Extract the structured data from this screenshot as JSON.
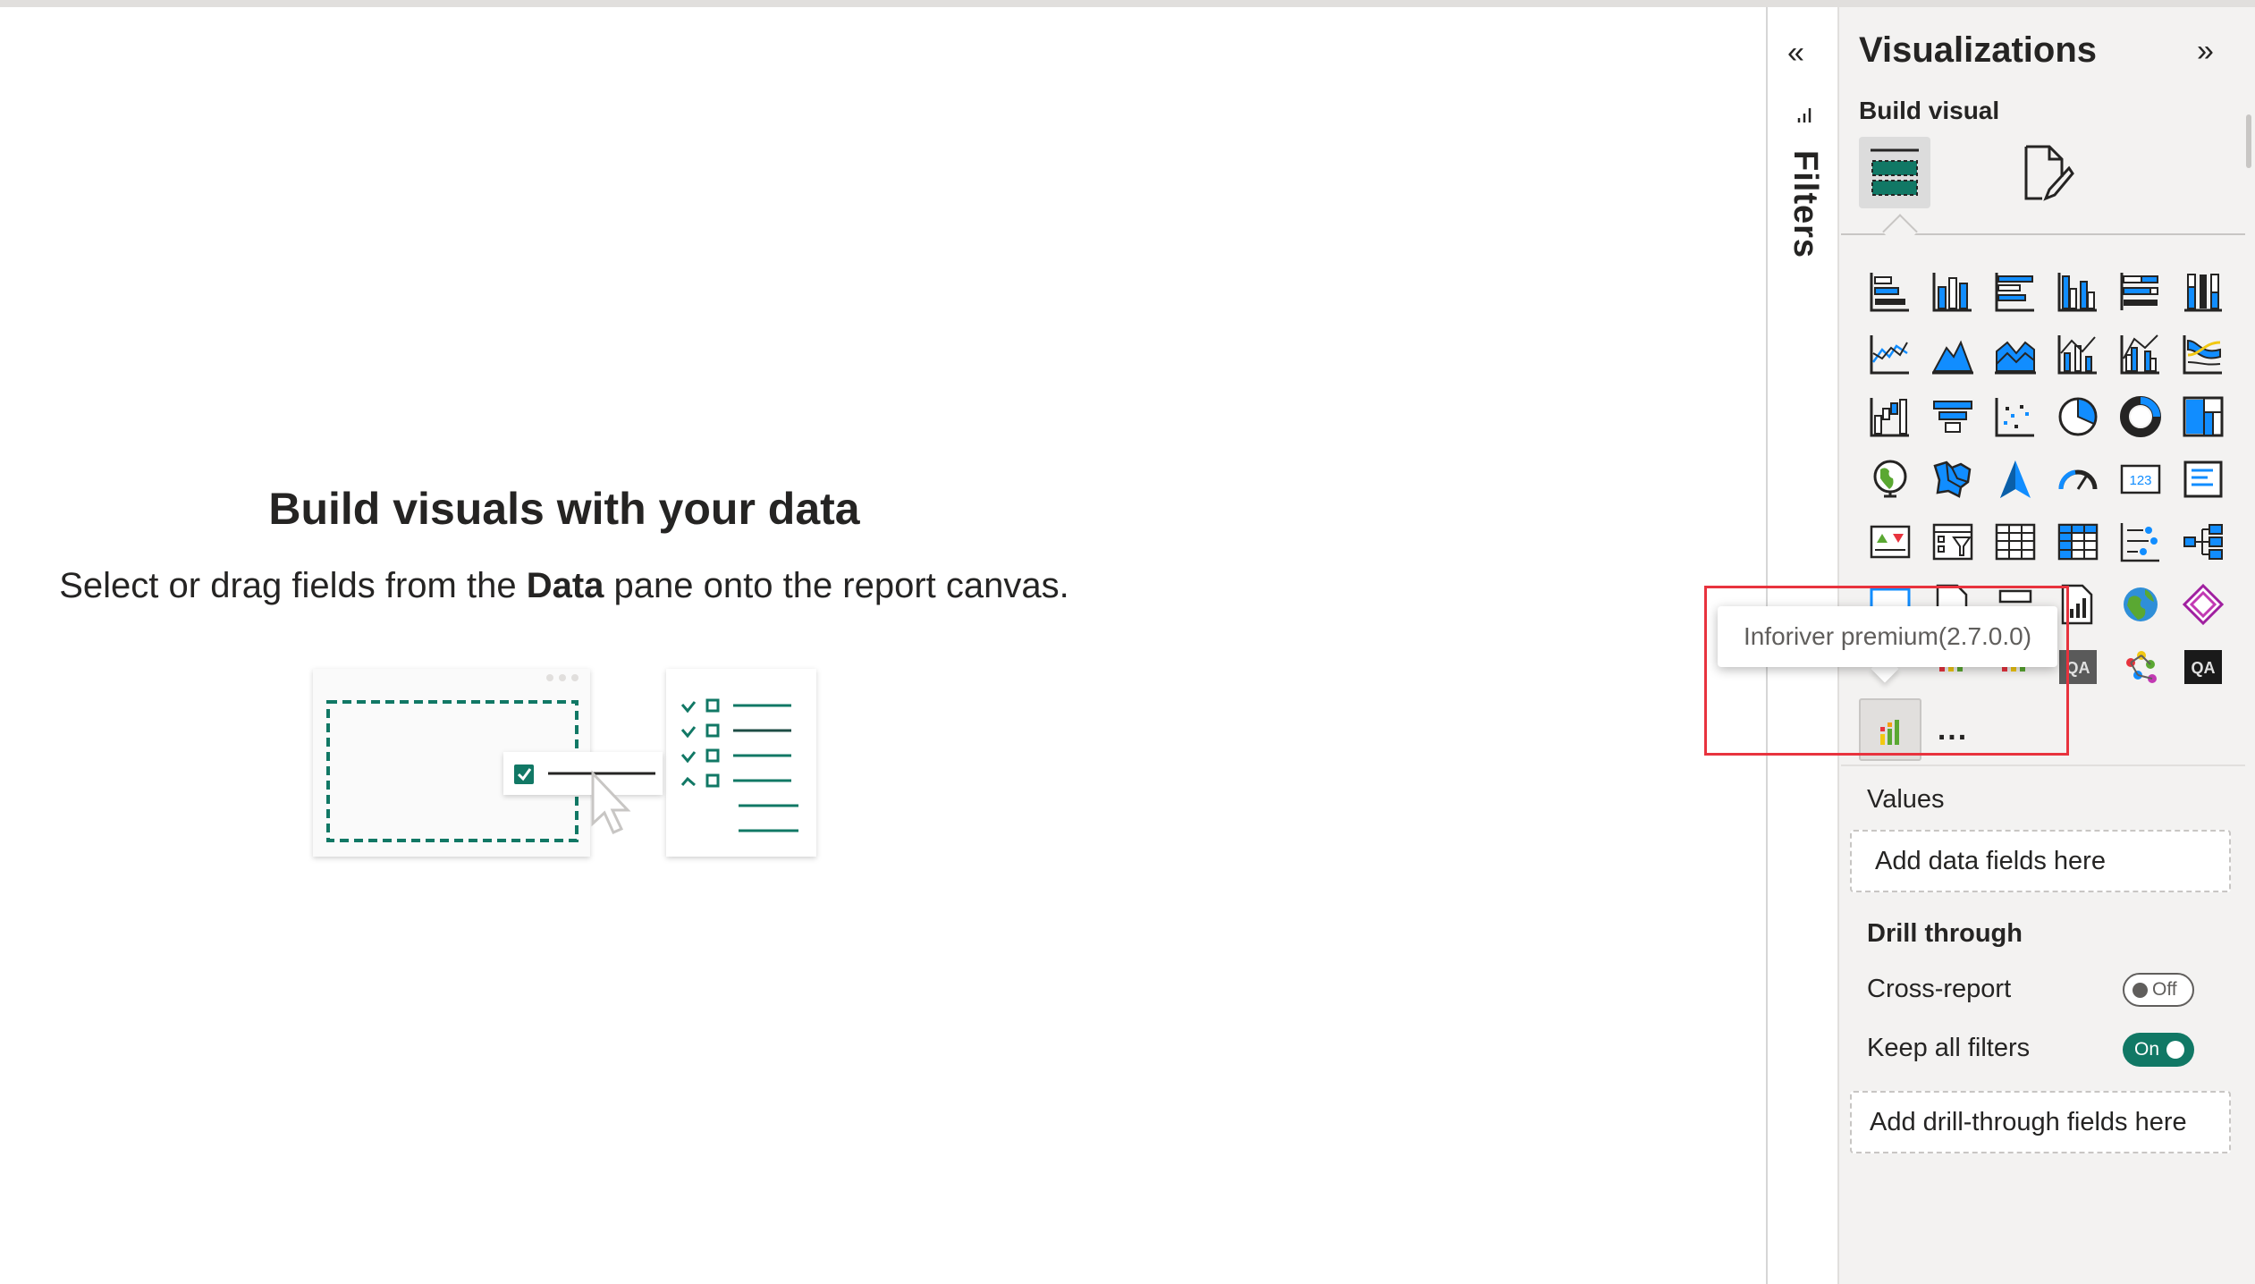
{
  "canvas": {
    "empty_title": "Build visuals with your data",
    "empty_sub_before": "Select or drag fields from the ",
    "empty_sub_bold": "Data",
    "empty_sub_after": " pane onto the report canvas."
  },
  "filters_rail": {
    "expand_icon": "double-chevron-left-icon",
    "label": "Filters"
  },
  "viz_pane": {
    "title": "Visualizations",
    "collapse_icon": "double-chevron-right-icon",
    "build_visual_label": "Build visual",
    "modes": [
      "build-visual-fields-mode",
      "format-visual-mode"
    ],
    "visual_icons": [
      "stacked-bar-chart",
      "stacked-column-chart",
      "clustered-bar-chart",
      "clustered-column-chart",
      "100-stacked-bar-chart",
      "100-stacked-column-chart",
      "line-chart",
      "area-chart",
      "stacked-area-chart",
      "line-and-stacked-column-chart",
      "line-and-clustered-column-chart",
      "ribbon-chart",
      "waterfall-chart",
      "funnel-chart",
      "scatter-chart",
      "pie-chart",
      "donut-chart",
      "treemap",
      "map",
      "filled-map",
      "azure-map",
      "gauge",
      "card",
      "multi-row-card",
      "kpi",
      "slicer",
      "table",
      "matrix",
      "key-influencers",
      "decomposition-tree",
      "qa-visual",
      "paginated-report",
      "smart-narrative",
      "power-apps-visual",
      "arcgis-map",
      "power-automate",
      "python-visual",
      "r-visual",
      "narrative",
      "qa-dark",
      "metrics",
      "qa-dark-2",
      "inforiver-premium",
      "more-visuals"
    ],
    "more_label": "..."
  },
  "tooltip": {
    "text": "Inforiver premium(2.7.0.0)"
  },
  "wells": {
    "values_label": "Values",
    "values_placeholder": "Add data fields here",
    "drill_label": "Drill through",
    "cross_report_label": "Cross-report",
    "cross_report_state": "Off",
    "keep_filters_label": "Keep all filters",
    "keep_filters_state": "On",
    "drill_placeholder": "Add drill-through fields here"
  },
  "colors": {
    "accent": "#117865",
    "highlight": "#e8333e",
    "icon_blue": "#118dff",
    "icon_dark": "#252423"
  }
}
